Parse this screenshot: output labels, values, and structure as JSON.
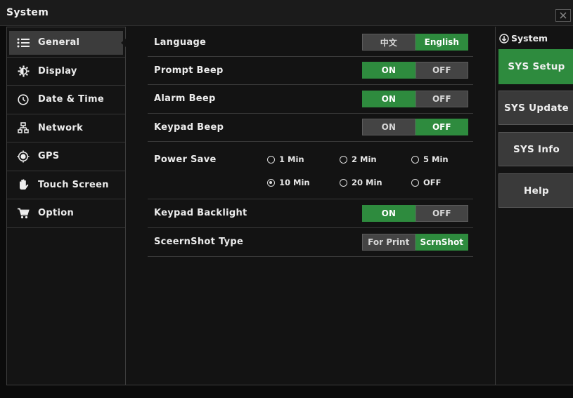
{
  "window": {
    "title": "System",
    "close_icon": "close-icon"
  },
  "colors": {
    "accent_green": "#2e8b3e",
    "control_gray": "#444444",
    "panel_background": "#131313",
    "selected_nav": "#3c3c3c"
  },
  "nav": {
    "items": [
      {
        "label": "General",
        "icon": "list-icon",
        "selected": true
      },
      {
        "label": "Display",
        "icon": "brightness-icon",
        "selected": false
      },
      {
        "label": "Date & Time",
        "icon": "clock-icon",
        "selected": false
      },
      {
        "label": "Network",
        "icon": "network-icon",
        "selected": false
      },
      {
        "label": "GPS",
        "icon": "gps-icon",
        "selected": false
      },
      {
        "label": "Touch Screen",
        "icon": "hand-icon",
        "selected": false
      },
      {
        "label": "Option",
        "icon": "cart-icon",
        "selected": false
      }
    ]
  },
  "settings": {
    "language": {
      "label": "Language",
      "options": [
        {
          "label": "中文",
          "on": false
        },
        {
          "label": "English",
          "on": true
        }
      ]
    },
    "prompt_beep": {
      "label": "Prompt Beep",
      "options": [
        {
          "label": "ON",
          "on": true
        },
        {
          "label": "OFF",
          "on": false
        }
      ]
    },
    "alarm_beep": {
      "label": "Alarm Beep",
      "options": [
        {
          "label": "ON",
          "on": true
        },
        {
          "label": "OFF",
          "on": false
        }
      ]
    },
    "keypad_beep": {
      "label": "Keypad Beep",
      "options": [
        {
          "label": "ON",
          "on": false
        },
        {
          "label": "OFF",
          "on": true
        }
      ]
    },
    "power_save": {
      "label": "Power Save",
      "options": [
        {
          "label": "1 Min",
          "on": false
        },
        {
          "label": "2 Min",
          "on": false
        },
        {
          "label": "5 Min",
          "on": false
        },
        {
          "label": "10 Min",
          "on": true
        },
        {
          "label": "20 Min",
          "on": false
        },
        {
          "label": "OFF",
          "on": false
        }
      ]
    },
    "keypad_backlight": {
      "label": "Keypad Backlight",
      "options": [
        {
          "label": "ON",
          "on": true
        },
        {
          "label": "OFF",
          "on": false
        }
      ]
    },
    "screenshot_type": {
      "label": "SceernShot Type",
      "options": [
        {
          "label": "For Print",
          "on": false
        },
        {
          "label": "ScrnShot",
          "on": true
        }
      ]
    }
  },
  "side_panel": {
    "heading": "System",
    "heading_icon": "circle-down-arrow-icon",
    "buttons": [
      {
        "label": "SYS Setup",
        "active": true
      },
      {
        "label": "SYS Update",
        "active": false
      },
      {
        "label": "SYS Info",
        "active": false
      },
      {
        "label": "Help",
        "active": false
      }
    ]
  }
}
